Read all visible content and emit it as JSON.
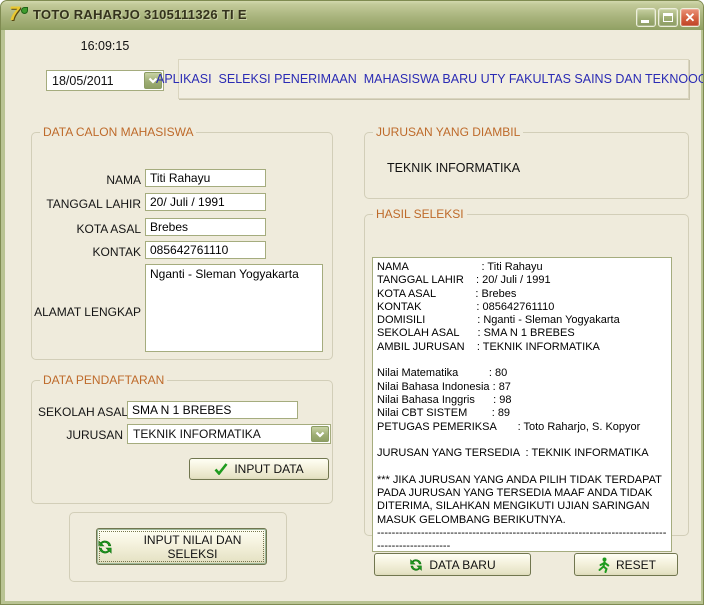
{
  "window": {
    "title": "TOTO RAHARJO 3105111326 TI E",
    "icon": "delphi-7-icon",
    "controls": {
      "minimize": "minimize",
      "maximize": "maximize",
      "close": "close"
    }
  },
  "colors": {
    "titlebar_olive": "#A8B37C",
    "form_background": "#EFEBDC",
    "group_title_orange": "#BE6A2A",
    "banner_text_blue": "#2B2BB4",
    "icon_green": "#1F9B1F",
    "close_button_red": "#D4603F"
  },
  "clock": {
    "time": "16:09:15",
    "date": "18/05/2011"
  },
  "banner": {
    "text": "APLIKASI  SELEKSI PENERIMAAN  MAHASISWA BARU UTY FAKULTAS SAINS DAN TEKNOOGI"
  },
  "data_calon": {
    "title": "DATA CALON MAHASISWA",
    "nama": {
      "label": "NAMA",
      "value": "Titi Rahayu"
    },
    "tanggal_lahir": {
      "label": "TANGGAL LAHIR",
      "value": "20/ Juli / 1991"
    },
    "kota_asal": {
      "label": "KOTA ASAL",
      "value": "Brebes"
    },
    "kontak": {
      "label": "KONTAK",
      "value": "085642761110"
    },
    "alamat": {
      "label": "ALAMAT LENGKAP",
      "value": "Nganti - Sleman Yogyakarta"
    }
  },
  "data_pendaftaran": {
    "title": "DATA PENDAFTARAN",
    "sekolah_asal": {
      "label": "SEKOLAH ASAL",
      "value": "SMA N 1 BREBES"
    },
    "jurusan": {
      "label": "JURUSAN",
      "selected": "TEKNIK INFORMATIKA"
    },
    "input_data_button": "INPUT DATA"
  },
  "input_nilai_button": "INPUT NILAI DAN SELEKSI",
  "jurusan_diambil": {
    "title": "JURUSAN YANG DIAMBIL",
    "value": "TEKNIK INFORMATIKA"
  },
  "hasil_seleksi": {
    "title": "HASIL SELEKSI",
    "lines": [
      "NAMA                        : Titi Rahayu",
      "TANGGAL LAHIR    : 20/ Juli / 1991",
      "KOTA ASAL             : Brebes",
      "KONTAK                  : 085642761110",
      "DOMISILI                 : Nganti - Sleman Yogyakarta",
      "SEKOLAH ASAL      : SMA N 1 BREBES",
      "AMBIL JURUSAN    : TEKNIK INFORMATIKA",
      "",
      "Nilai Matematika          : 80",
      "Nilai Bahasa Indonesia : 87",
      "Nilai Bahasa Inggris      : 98",
      "Nilai CBT SISTEM        : 89",
      "PETUGAS PEMERIKSA       : Toto Raharjo, S. Kopyor",
      "",
      "JURUSAN YANG TERSEDIA  : TEKNIK INFORMATIKA",
      "",
      "*** JIKA JURUSAN YANG ANDA PILIH TIDAK TERDAPAT",
      "PADA JURUSAN YANG TERSEDIA MAAF ANDA TIDAK",
      "DITERIMA, SILAHKAN MENGIKUTI UJIAN SARINGAN",
      "MASUK GELOMBANG BERIKUTNYA.",
      "---------------------------------------------------------------------------------------------------"
    ]
  },
  "footer_buttons": {
    "data_baru": "DATA BARU",
    "reset": "RESET"
  },
  "icons": {
    "input_data": "check-icon",
    "input_nilai": "refresh-arrows-icon",
    "data_baru": "refresh-arrows-icon",
    "reset": "running-man-icon",
    "combo": "chevron-down-icon"
  }
}
